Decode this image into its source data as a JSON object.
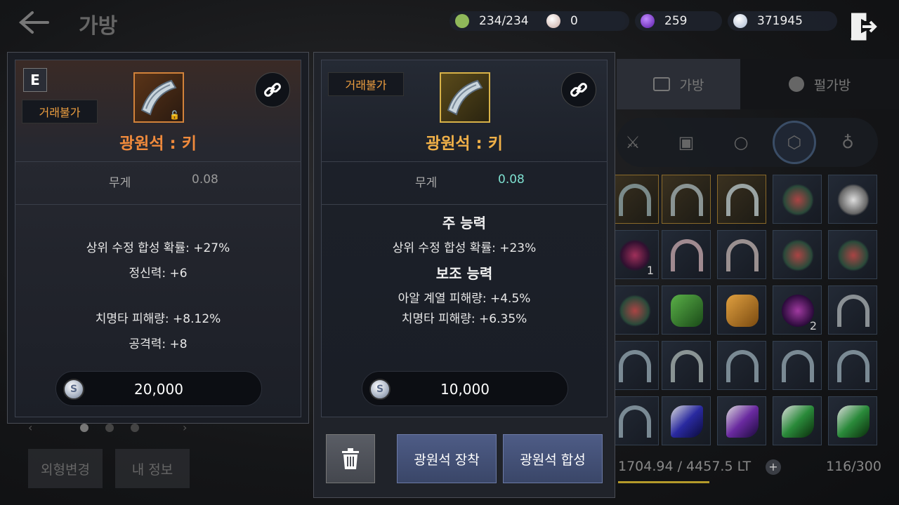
{
  "header": {
    "title": "가방",
    "currencies": [
      {
        "icon": "stamina-leaf-icon",
        "value": "234/234",
        "color": "#8fb85a"
      },
      {
        "icon": "pearl-icon",
        "value": "0",
        "color": "#e6d6d0"
      },
      {
        "icon": "purple-gem-icon",
        "value": "259",
        "color": "#7a3ad8"
      },
      {
        "icon": "silver-coin-icon",
        "value": "371945",
        "color": "#c8d4e8"
      }
    ]
  },
  "inventory": {
    "tabs": [
      "가방",
      "펄가방"
    ],
    "weight": "1704.94 / 4457.5 LT",
    "slots": "116/300",
    "counts": [
      "1",
      "2"
    ],
    "left_buttons": [
      "외형변경",
      "내 정보"
    ]
  },
  "left_panel": {
    "grade": "E",
    "tag": "거래불가",
    "name": "광원석 : 키",
    "name_color": "#f08a3c",
    "weight_label": "무게",
    "weight_value": "0.08",
    "stats": [
      "상위 수정 합성 확률: +27%",
      "정신력: +6",
      "치명타 피해량: +8.12%",
      "공격력: +8"
    ],
    "price": "20,000"
  },
  "right_panel": {
    "tag": "거래불가",
    "name": "광원석 : 키",
    "name_color": "#f0b048",
    "weight_label": "무게",
    "weight_value": "0.08",
    "main_heading": "주 능력",
    "main_stats": [
      "상위 수정 합성 확률: +23%"
    ],
    "sub_heading": "보조 능력",
    "sub_stats": [
      "아알 계열 피해량: +4.5%",
      "치명타 피해량: +6.35%"
    ],
    "price": "10,000",
    "equip_button": "광원석 장착",
    "combine_button": "광원석 합성"
  }
}
